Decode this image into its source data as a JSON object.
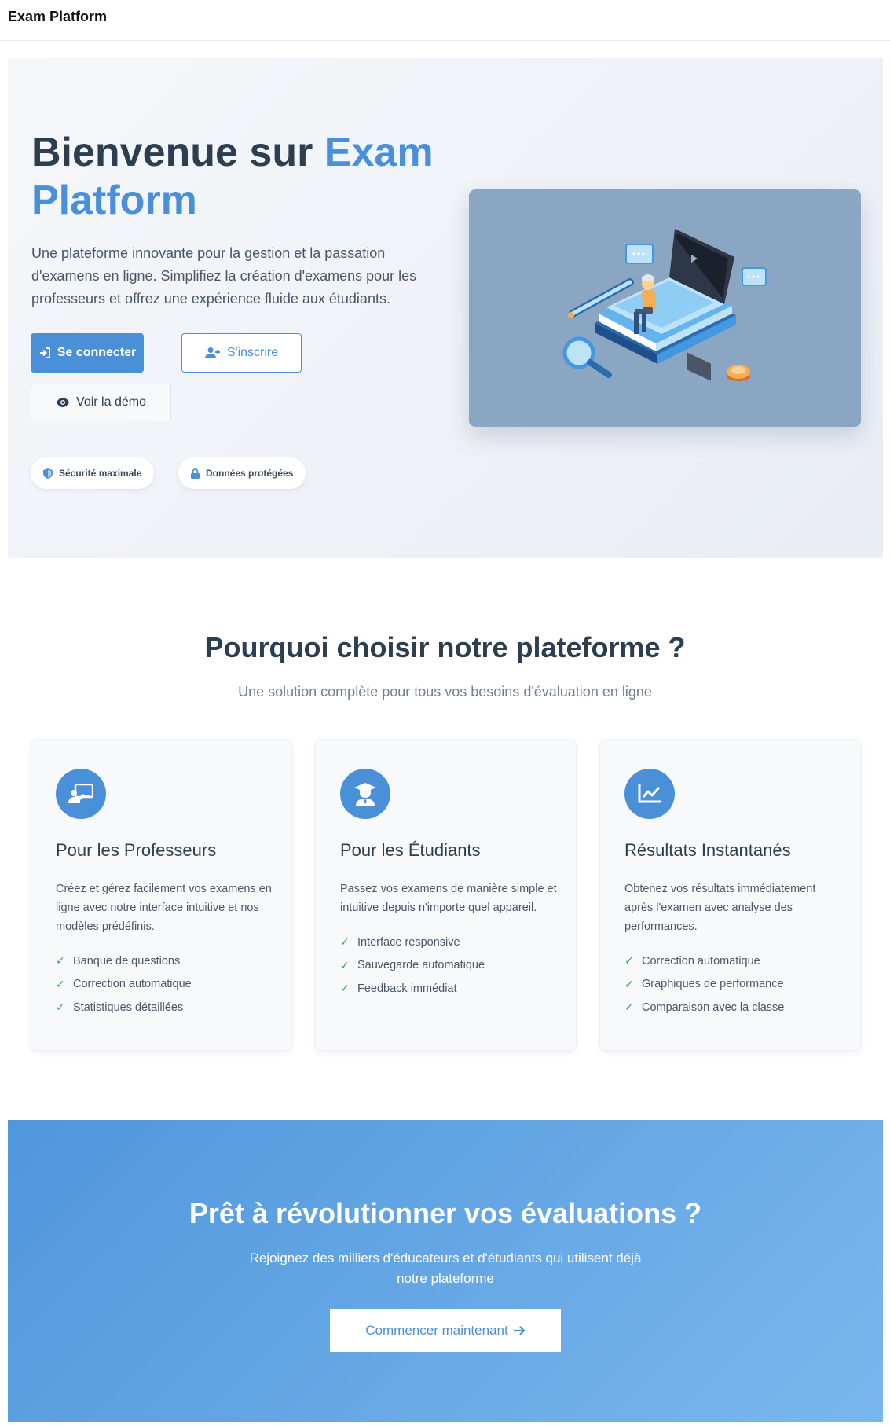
{
  "header": {
    "brand": "Exam Platform"
  },
  "hero": {
    "title_part1": "Bienvenue sur ",
    "title_accent": "Exam Platform",
    "description": "Une plateforme innovante pour la gestion et la passation d'examens en ligne. Simplifiez la création d'examens pour les professeurs et offrez une expérience fluide aux étudiants.",
    "login_label": "Se connecter",
    "register_label": "S'inscrire",
    "demo_label": "Voir la démo",
    "badges": [
      "Sécurité maximale",
      "Données protégées"
    ]
  },
  "features": {
    "title": "Pourquoi choisir notre plateforme ?",
    "subtitle": "Une solution complète pour tous vos besoins d'évaluation en ligne",
    "cards": [
      {
        "title": "Pour les Professeurs",
        "description": "Créez et gérez facilement vos examens en ligne avec notre interface intuitive et nos modèles prédéfinis.",
        "items": [
          "Banque de questions",
          "Correction automatique",
          "Statistiques détaillées"
        ],
        "icon": "chalkboard-teacher-icon"
      },
      {
        "title": "Pour les Étudiants",
        "description": "Passez vos examens de manière simple et intuitive depuis n'importe quel appareil.",
        "items": [
          "Interface responsive",
          "Sauvegarde automatique",
          "Feedback immédiat"
        ],
        "icon": "graduate-icon"
      },
      {
        "title": "Résultats Instantanés",
        "description": "Obtenez vos résultats immédiatement après l'examen avec analyse des performances.",
        "items": [
          "Correction automatique",
          "Graphiques de performance",
          "Comparaison avec la classe"
        ],
        "icon": "chart-line-icon"
      }
    ]
  },
  "cta": {
    "title": "Prêt à révolutionner vos évaluations ?",
    "subtitle": "Rejoignez des milliers d'éducateurs et d'étudiants qui utilisent déjà notre plateforme",
    "button_label": "Commencer maintenant"
  },
  "colors": {
    "accent": "#4a90d9",
    "text": "#2c3e50",
    "check": "#38a169"
  }
}
